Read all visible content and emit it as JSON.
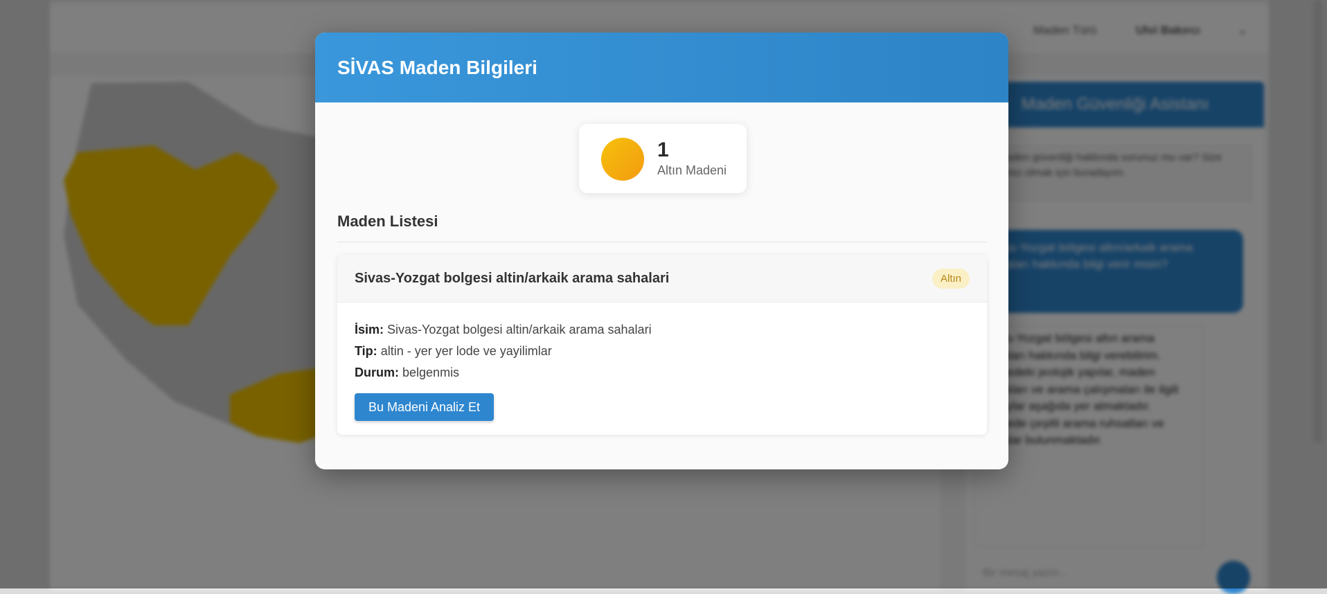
{
  "background": {
    "nav": {
      "link1": "Maden Türü",
      "link2": "Ulvi Bakırcı",
      "chevron": "⌄"
    },
    "side_panel": {
      "title": "Maden Güvenliği Asistanı",
      "info": "Bir maden güvenliği hakkında sorunuz mu var? Size yardımcı olmak için buradayım.",
      "bubble": "Sivas-Yozgat bölgesi altın/arkaik arama sahaları hakkında bilgi verir misin?",
      "reply": "Sivas-Yozgat bölgesi altın arama sahaları hakkında bilgi verebilirim. Bölgedeki jeolojik yapılar, maden yatakları ve arama çalışmaları ile ilgili detaylar aşağıda yer almaktadır. Bölgede çeşitli arama ruhsatları ve sahalar bulunmaktadır.",
      "chat_placeholder": "Bir mesaj yazın..."
    }
  },
  "modal": {
    "title": "SİVAS Maden Bilgileri",
    "stat": {
      "count": "1",
      "label": "Altın Madeni",
      "color": "#f6b70e"
    },
    "list_title": "Maden Listesi",
    "mines": [
      {
        "name": "Sivas-Yozgat bolgesi altin/arkaik arama sahalari",
        "badge": "Altın",
        "fields": {
          "name_label": "İsim:",
          "name_value": "Sivas-Yozgat bolgesi altin/arkaik arama sahalari",
          "type_label": "Tip:",
          "type_value": "altin - yer yer lode ve yayilimlar",
          "status_label": "Durum:",
          "status_value": "belgenmis"
        },
        "button": "Bu Madeni Analiz Et"
      }
    ]
  },
  "colors": {
    "header_blue": "#3a97db",
    "button_blue": "#2e86cf",
    "badge_bg": "#fbefc6",
    "map_highlight": "#f2c300"
  }
}
